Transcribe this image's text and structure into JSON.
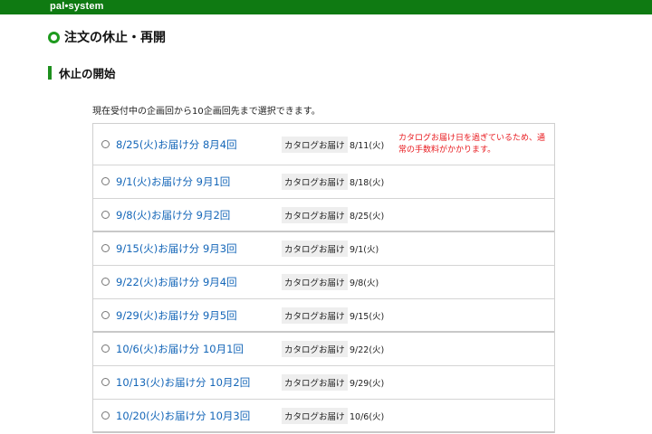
{
  "header": {
    "logo": "pal•system"
  },
  "page_title": "注文の休止・再開",
  "section_title": "休止の開始",
  "intro": "現在受付中の企画回から10企画回先まで選択できます。",
  "catalog_label": "カタログお届け",
  "colors": {
    "brand_green": "#0f7a12",
    "link_blue": "#1466b8",
    "warning_red": "#e8191e"
  },
  "options": [
    {
      "label": "8/25(火)お届け分 8月4回",
      "catalog_date": "8/11(火)",
      "warning": "カタログお届け日を過ぎているため、通常の手数料がかかります。"
    },
    {
      "label": "9/1(火)お届け分 9月1回",
      "catalog_date": "8/18(火)"
    },
    {
      "label": "9/8(火)お届け分 9月2回",
      "catalog_date": "8/25(火)"
    },
    {
      "label": "9/15(火)お届け分 9月3回",
      "catalog_date": "9/1(火)"
    },
    {
      "label": "9/22(火)お届け分 9月4回",
      "catalog_date": "9/8(火)"
    },
    {
      "label": "9/29(火)お届け分 9月5回",
      "catalog_date": "9/15(火)"
    },
    {
      "label": "10/6(火)お届け分 10月1回",
      "catalog_date": "9/22(火)"
    },
    {
      "label": "10/13(火)お届け分 10月2回",
      "catalog_date": "9/29(火)"
    },
    {
      "label": "10/20(火)お届け分 10月3回",
      "catalog_date": "10/6(火)"
    }
  ]
}
